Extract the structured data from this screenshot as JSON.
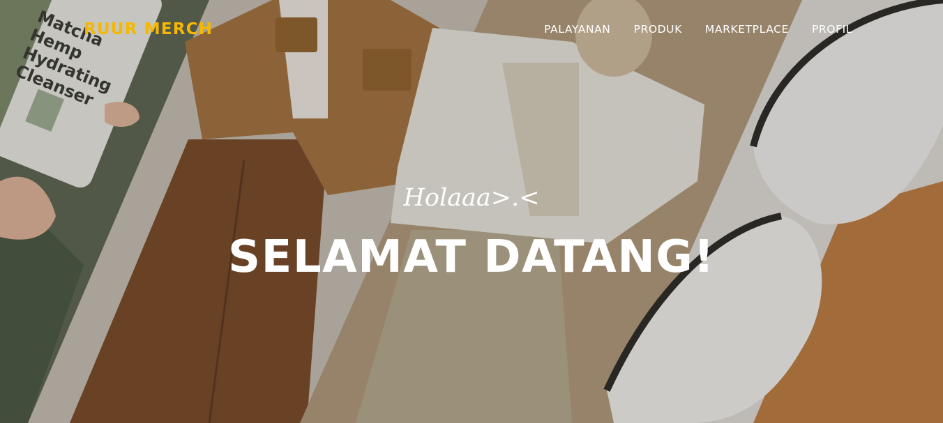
{
  "brand": {
    "name": "RUUR MERCH"
  },
  "nav": {
    "items": [
      {
        "label": "PALAYANAN"
      },
      {
        "label": "PRODUK"
      },
      {
        "label": "MARKETPLACE"
      },
      {
        "label": "PROFIL"
      }
    ]
  },
  "hero": {
    "greeting": "Holaaa>.<",
    "headline": "SELAMAT DATANG!",
    "product_label": {
      "line1": "Matcha",
      "line2": "Hemp",
      "line3": "Hydrating",
      "line4": "Cleanser"
    }
  },
  "colors": {
    "brand": "#f5b800",
    "text": "#ffffff"
  }
}
